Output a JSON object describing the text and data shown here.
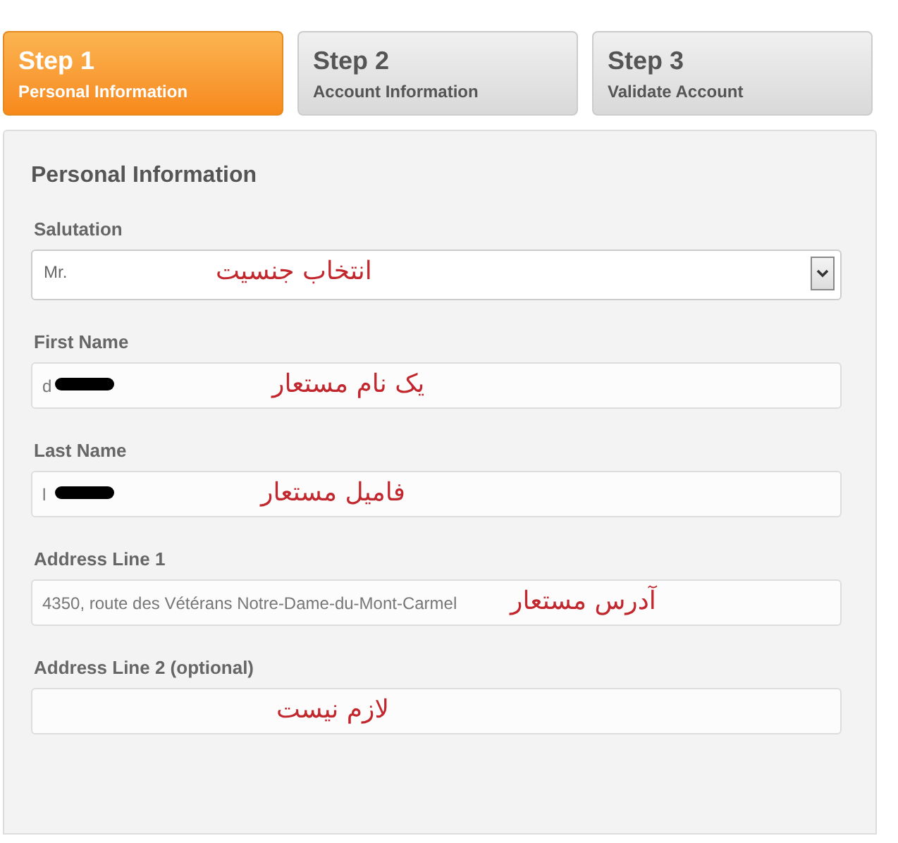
{
  "steps": [
    {
      "title": "Step 1",
      "subtitle": "Personal Information",
      "selected": true
    },
    {
      "title": "Step 2",
      "subtitle": "Account Information",
      "selected": false
    },
    {
      "title": "Step 3",
      "subtitle": "Validate Account",
      "selected": false
    }
  ],
  "section_title": "Personal Information",
  "fields": [
    {
      "kind": "select",
      "label": "Salutation",
      "value": "Mr.",
      "redacted": false,
      "annotation": "انتخاب جنسیت"
    },
    {
      "kind": "text",
      "label": "First Name",
      "value": "d",
      "redacted": true,
      "annotation": "یک نام مستعار"
    },
    {
      "kind": "text",
      "label": "Last Name",
      "value": "l",
      "redacted": true,
      "annotation": "فامیل مستعار"
    },
    {
      "kind": "text",
      "label": "Address Line 1",
      "value": "4350, route des Vétérans Notre-Dame-du-Mont-Carmel",
      "redacted": false,
      "annotation": "آدرس مستعار"
    },
    {
      "kind": "text",
      "label": "Address Line 2 (optional)",
      "redacted": false,
      "annotation": "لازم نیست"
    }
  ]
}
